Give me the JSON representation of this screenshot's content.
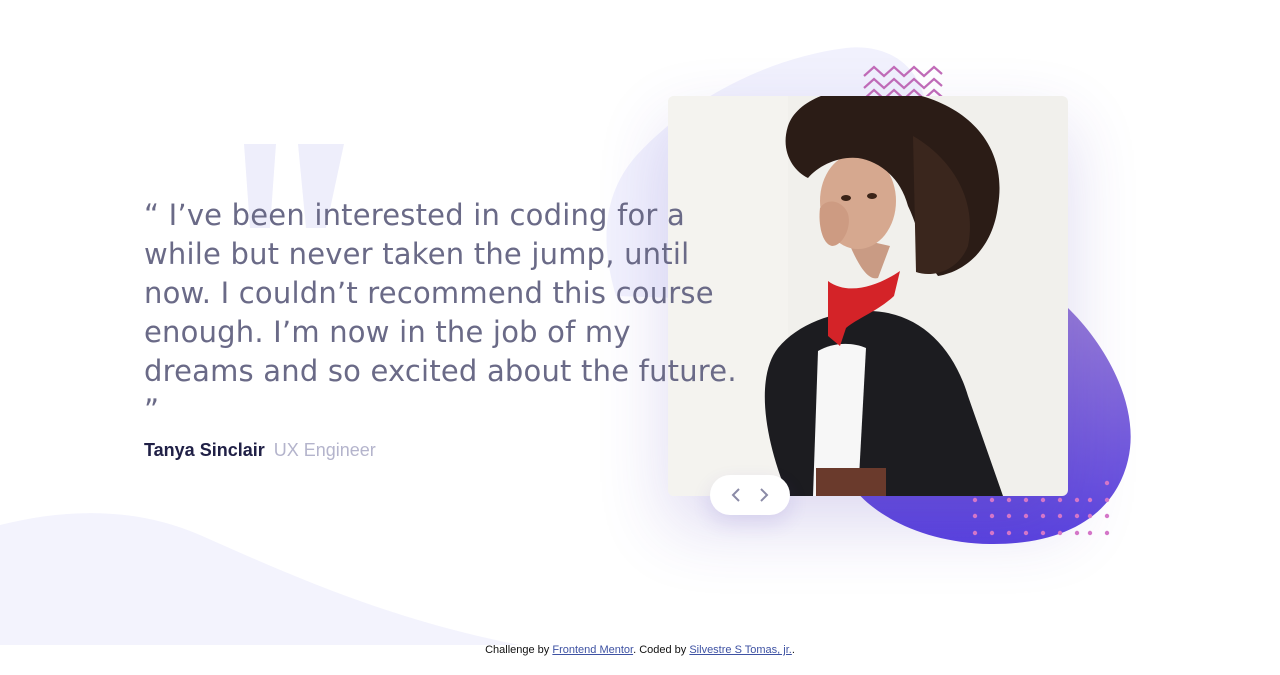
{
  "testimonial": {
    "quote": "“ I’ve been interested in coding for a while but never taken the jump, until now. I couldn’t recommend this course enough. I’m now in the job of my dreams and so excited about the future. ”",
    "author_name": "Tanya Sinclair",
    "author_role": "UX Engineer"
  },
  "slider": {
    "prev_icon": "chevron-left-icon",
    "next_icon": "chevron-right-icon"
  },
  "footer": {
    "prefix": "Challenge by ",
    "challenge_link": "Frontend Mentor",
    "middle": ". Coded by ",
    "author_link": "Silvestre S Tomas, jr.",
    "suffix": "."
  },
  "colors": {
    "text": "#6a6a87",
    "name": "#202046",
    "role": "#b4b4cc",
    "accent_purple": "#6544d9",
    "pattern_pink": "#c26cb8",
    "pattern_light": "#eeeefb",
    "link": "#3e52a3"
  }
}
